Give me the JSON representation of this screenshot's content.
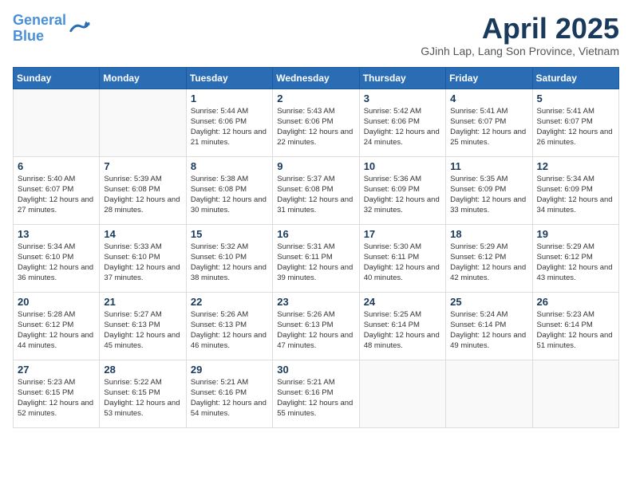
{
  "logo": {
    "line1": "General",
    "line2": "Blue"
  },
  "title": "April 2025",
  "subtitle": "GJinh Lap, Lang Son Province, Vietnam",
  "days_header": [
    "Sunday",
    "Monday",
    "Tuesday",
    "Wednesday",
    "Thursday",
    "Friday",
    "Saturday"
  ],
  "weeks": [
    [
      {
        "day": "",
        "info": ""
      },
      {
        "day": "",
        "info": ""
      },
      {
        "day": "1",
        "info": "Sunrise: 5:44 AM\nSunset: 6:06 PM\nDaylight: 12 hours and 21 minutes."
      },
      {
        "day": "2",
        "info": "Sunrise: 5:43 AM\nSunset: 6:06 PM\nDaylight: 12 hours and 22 minutes."
      },
      {
        "day": "3",
        "info": "Sunrise: 5:42 AM\nSunset: 6:06 PM\nDaylight: 12 hours and 24 minutes."
      },
      {
        "day": "4",
        "info": "Sunrise: 5:41 AM\nSunset: 6:07 PM\nDaylight: 12 hours and 25 minutes."
      },
      {
        "day": "5",
        "info": "Sunrise: 5:41 AM\nSunset: 6:07 PM\nDaylight: 12 hours and 26 minutes."
      }
    ],
    [
      {
        "day": "6",
        "info": "Sunrise: 5:40 AM\nSunset: 6:07 PM\nDaylight: 12 hours and 27 minutes."
      },
      {
        "day": "7",
        "info": "Sunrise: 5:39 AM\nSunset: 6:08 PM\nDaylight: 12 hours and 28 minutes."
      },
      {
        "day": "8",
        "info": "Sunrise: 5:38 AM\nSunset: 6:08 PM\nDaylight: 12 hours and 30 minutes."
      },
      {
        "day": "9",
        "info": "Sunrise: 5:37 AM\nSunset: 6:08 PM\nDaylight: 12 hours and 31 minutes."
      },
      {
        "day": "10",
        "info": "Sunrise: 5:36 AM\nSunset: 6:09 PM\nDaylight: 12 hours and 32 minutes."
      },
      {
        "day": "11",
        "info": "Sunrise: 5:35 AM\nSunset: 6:09 PM\nDaylight: 12 hours and 33 minutes."
      },
      {
        "day": "12",
        "info": "Sunrise: 5:34 AM\nSunset: 6:09 PM\nDaylight: 12 hours and 34 minutes."
      }
    ],
    [
      {
        "day": "13",
        "info": "Sunrise: 5:34 AM\nSunset: 6:10 PM\nDaylight: 12 hours and 36 minutes."
      },
      {
        "day": "14",
        "info": "Sunrise: 5:33 AM\nSunset: 6:10 PM\nDaylight: 12 hours and 37 minutes."
      },
      {
        "day": "15",
        "info": "Sunrise: 5:32 AM\nSunset: 6:10 PM\nDaylight: 12 hours and 38 minutes."
      },
      {
        "day": "16",
        "info": "Sunrise: 5:31 AM\nSunset: 6:11 PM\nDaylight: 12 hours and 39 minutes."
      },
      {
        "day": "17",
        "info": "Sunrise: 5:30 AM\nSunset: 6:11 PM\nDaylight: 12 hours and 40 minutes."
      },
      {
        "day": "18",
        "info": "Sunrise: 5:29 AM\nSunset: 6:12 PM\nDaylight: 12 hours and 42 minutes."
      },
      {
        "day": "19",
        "info": "Sunrise: 5:29 AM\nSunset: 6:12 PM\nDaylight: 12 hours and 43 minutes."
      }
    ],
    [
      {
        "day": "20",
        "info": "Sunrise: 5:28 AM\nSunset: 6:12 PM\nDaylight: 12 hours and 44 minutes."
      },
      {
        "day": "21",
        "info": "Sunrise: 5:27 AM\nSunset: 6:13 PM\nDaylight: 12 hours and 45 minutes."
      },
      {
        "day": "22",
        "info": "Sunrise: 5:26 AM\nSunset: 6:13 PM\nDaylight: 12 hours and 46 minutes."
      },
      {
        "day": "23",
        "info": "Sunrise: 5:26 AM\nSunset: 6:13 PM\nDaylight: 12 hours and 47 minutes."
      },
      {
        "day": "24",
        "info": "Sunrise: 5:25 AM\nSunset: 6:14 PM\nDaylight: 12 hours and 48 minutes."
      },
      {
        "day": "25",
        "info": "Sunrise: 5:24 AM\nSunset: 6:14 PM\nDaylight: 12 hours and 49 minutes."
      },
      {
        "day": "26",
        "info": "Sunrise: 5:23 AM\nSunset: 6:14 PM\nDaylight: 12 hours and 51 minutes."
      }
    ],
    [
      {
        "day": "27",
        "info": "Sunrise: 5:23 AM\nSunset: 6:15 PM\nDaylight: 12 hours and 52 minutes."
      },
      {
        "day": "28",
        "info": "Sunrise: 5:22 AM\nSunset: 6:15 PM\nDaylight: 12 hours and 53 minutes."
      },
      {
        "day": "29",
        "info": "Sunrise: 5:21 AM\nSunset: 6:16 PM\nDaylight: 12 hours and 54 minutes."
      },
      {
        "day": "30",
        "info": "Sunrise: 5:21 AM\nSunset: 6:16 PM\nDaylight: 12 hours and 55 minutes."
      },
      {
        "day": "",
        "info": ""
      },
      {
        "day": "",
        "info": ""
      },
      {
        "day": "",
        "info": ""
      }
    ]
  ]
}
